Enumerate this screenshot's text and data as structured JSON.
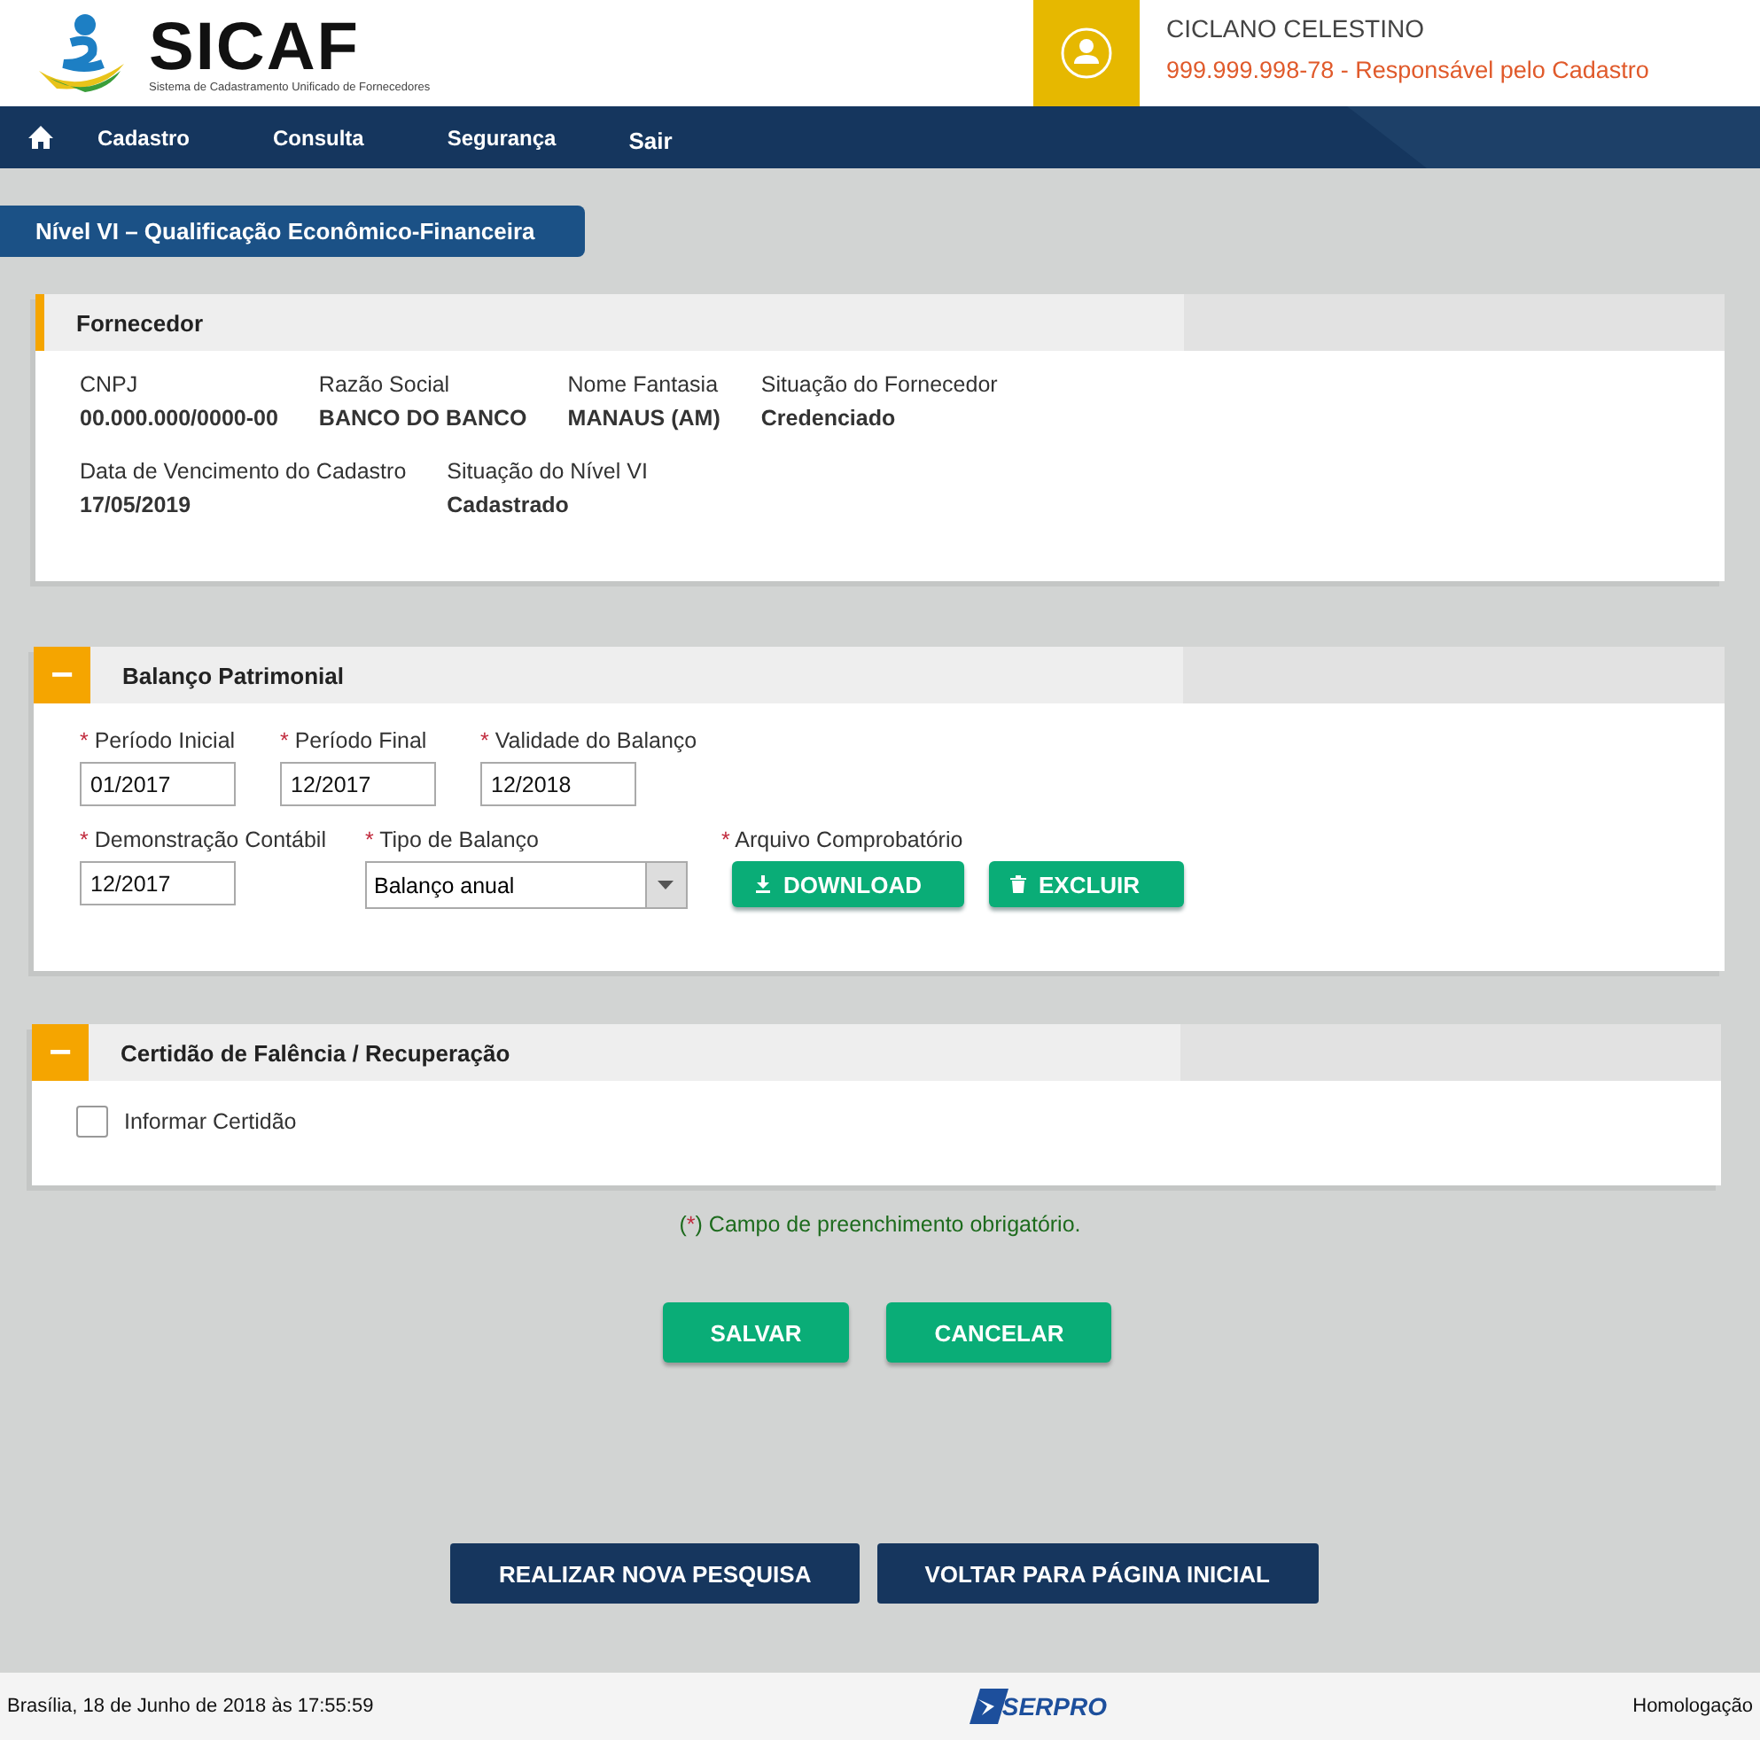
{
  "header": {
    "logo_title": "SICAF",
    "logo_subtitle": "Sistema de Cadastramento Unificado de Fornecedores",
    "user_name": "CICLANO CELESTINO",
    "user_id": "999.999.998-78",
    "user_role": " - Responsável pelo Cadastro"
  },
  "nav": {
    "items": [
      {
        "label": "Cadastro"
      },
      {
        "label": "Consulta"
      },
      {
        "label": "Segurança"
      },
      {
        "label": "Sair"
      }
    ]
  },
  "page_title": "Nível VI – Qualificação Econômico-Financeira",
  "fornecedor": {
    "title": "Fornecedor",
    "rows": [
      [
        {
          "label": "CNPJ",
          "value": "00.000.000/0000-00"
        },
        {
          "label": "Razão Social",
          "value": "BANCO DO BANCO"
        },
        {
          "label": "Nome Fantasia",
          "value": "MANAUS (AM)"
        },
        {
          "label": "Situação do Fornecedor",
          "value": "Credenciado"
        }
      ],
      [
        {
          "label": "Data de Vencimento do Cadastro",
          "value": "17/05/2019"
        },
        {
          "label": "Situação do Nível VI",
          "value": "Cadastrado"
        }
      ]
    ]
  },
  "balanco": {
    "title": "Balanço Patrimonial",
    "toggle": "−",
    "expanded": true,
    "rows": [
      [
        {
          "kind": "text",
          "mark": "*",
          "label": "Período Inicial",
          "value": "01/2017"
        },
        {
          "kind": "text",
          "mark": "*",
          "label": "Período Final",
          "value": "12/2017"
        },
        {
          "kind": "text",
          "mark": "*",
          "label": "Validade do Balanço",
          "value": "12/2018"
        }
      ],
      [
        {
          "kind": "text",
          "mark": "*",
          "label": "Demonstração Contábil",
          "value": "12/2017"
        },
        {
          "kind": "select",
          "mark": "*",
          "label": "Tipo de Balanço",
          "value": "Balanço anual"
        },
        {
          "kind": "files",
          "mark": "*",
          "label": "Arquivo Comprobatório",
          "buttons": [
            {
              "label": "DOWNLOAD",
              "kind": "download"
            },
            {
              "label": "EXCLUIR",
              "kind": "delete"
            }
          ]
        }
      ]
    ]
  },
  "certidao": {
    "title": "Certidão de Falência / Recuperação",
    "toggle": "−",
    "expanded": true,
    "checkbox": {
      "label": "Informar Certidão",
      "checked": false
    }
  },
  "note": {
    "open": "(",
    "mark": "*",
    "rest": ") Campo de preenchimento obrigatório."
  },
  "actions": [
    "SALVAR",
    "CANCELAR"
  ],
  "bottom_buttons": [
    "REALIZAR NOVA PESQUISA",
    "VOLTAR PARA PÁGINA INICIAL"
  ],
  "footer": {
    "datetime": "Brasília, 18 de Junho de 2018 às 17:55:59",
    "logo": "SERPRO",
    "environment": "Homologação"
  }
}
